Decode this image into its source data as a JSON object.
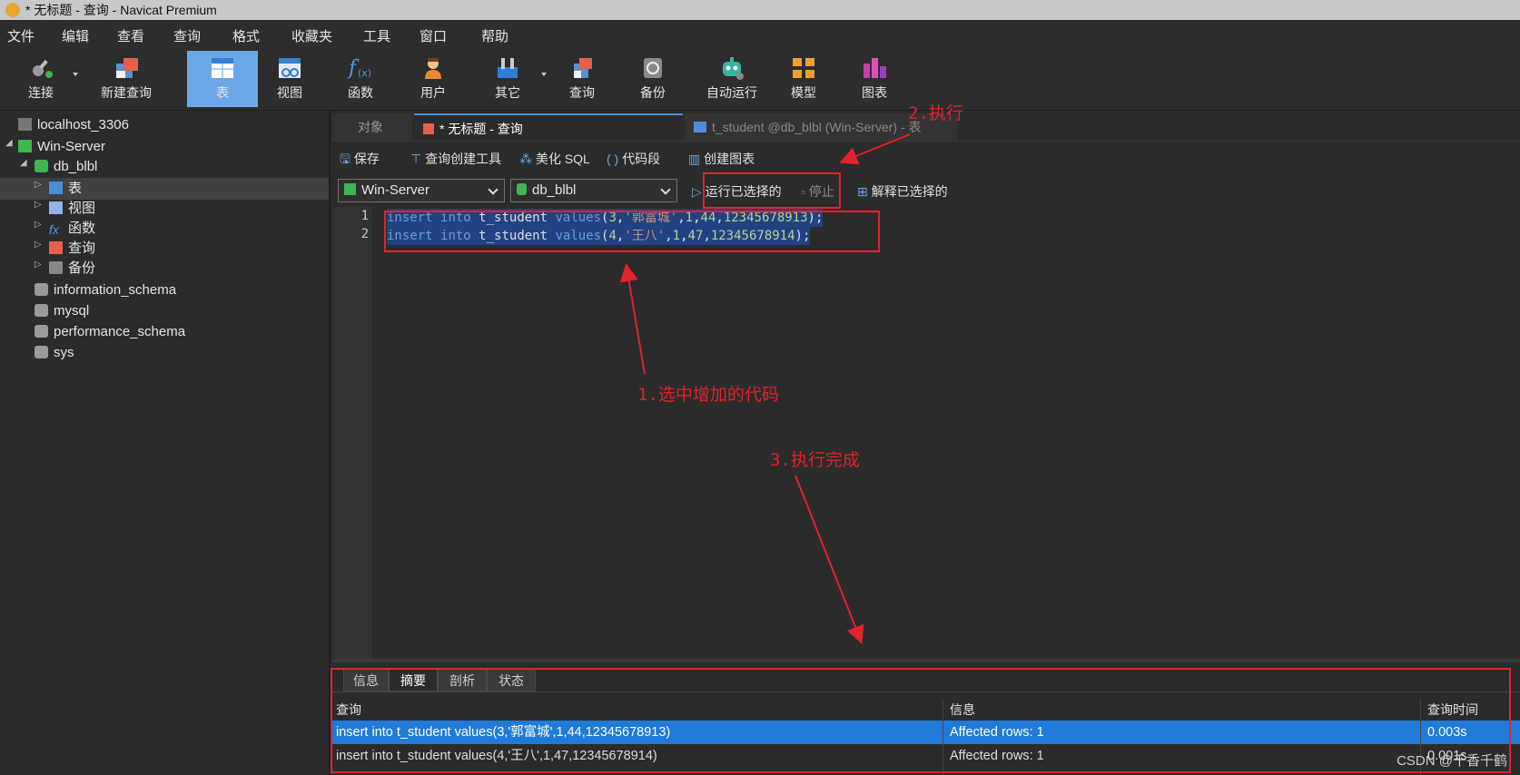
{
  "window": {
    "title": "* 无标题 - 查询 - Navicat Premium"
  },
  "menu": [
    "文件",
    "编辑",
    "查看",
    "查询",
    "格式",
    "收藏夹",
    "工具",
    "窗口",
    "帮助"
  ],
  "toolbar": [
    "连接",
    "新建查询",
    "表",
    "视图",
    "函数",
    "用户",
    "其它",
    "查询",
    "备份",
    "自动运行",
    "模型",
    "图表"
  ],
  "tree": {
    "conn1": "localhost_3306",
    "conn2": "Win-Server",
    "db": "db_blbl",
    "children": [
      "表",
      "视图",
      "函数",
      "查询",
      "备份"
    ],
    "other_dbs": [
      "information_schema",
      "mysql",
      "performance_schema",
      "sys"
    ]
  },
  "tabs": [
    "对象",
    "* 无标题 - 查询",
    "t_student @db_blbl (Win-Server) - 表"
  ],
  "query_toolbar": [
    "保存",
    "查询创建工具",
    "美化 SQL",
    "代码段",
    "创建图表"
  ],
  "selectors": {
    "connection": "Win-Server",
    "database": "db_blbl"
  },
  "run_actions": [
    "运行已选择的",
    "停止",
    "解释已选择的"
  ],
  "editor": {
    "lines": [
      {
        "no": "1",
        "kw1": "insert",
        "kw2": "into",
        "table": "t_student",
        "kw3": "values",
        "a": "3",
        "name": "'郭富城'",
        "b": "1",
        "c": "44",
        "d": "12345678913"
      },
      {
        "no": "2",
        "kw1": "insert",
        "kw2": "into",
        "table": "t_student",
        "kw3": "values",
        "a": "4",
        "name": "'王八'",
        "b": "1",
        "c": "47",
        "d": "12345678914"
      }
    ]
  },
  "results": {
    "tabs": [
      "信息",
      "摘要",
      "剖析",
      "状态"
    ],
    "columns": [
      "查询",
      "信息",
      "查询时间"
    ],
    "rows": [
      [
        "insert into t_student values(3,'郭富城',1,44,12345678913)",
        "Affected rows: 1",
        "0.003s"
      ],
      [
        "insert into t_student values(4,'王八',1,47,12345678914)",
        "Affected rows: 1",
        "0.001s"
      ]
    ]
  },
  "annotations": [
    "2.执行",
    "1.选中增加的代码",
    "3.执行完成"
  ],
  "watermark": "CSDN @千香千鹤",
  "colors": {
    "annotation": "#e3222a",
    "selection": "#1f7ad8",
    "active_tool": "#6ba8e8"
  }
}
